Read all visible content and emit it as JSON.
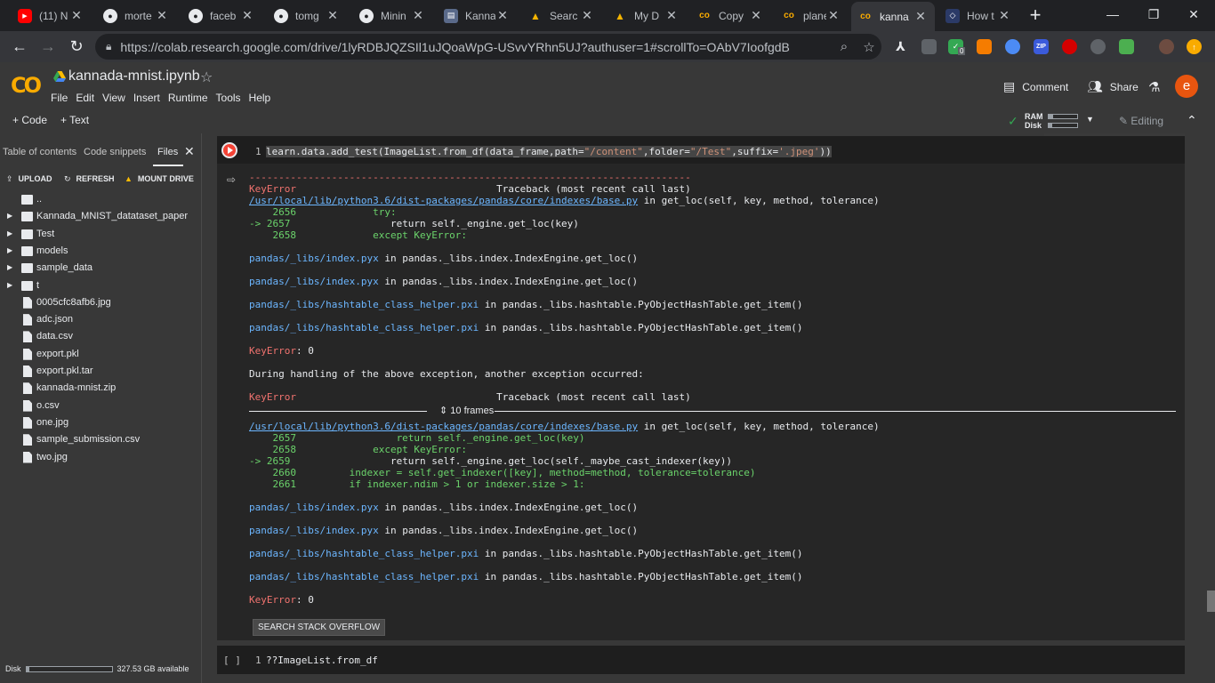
{
  "tabs": [
    {
      "label": "(11) N",
      "favicon": "youtube-icon",
      "color": "#ff0000",
      "glyph": "▶"
    },
    {
      "label": "morte",
      "favicon": "github-icon",
      "color": "#e8eaed",
      "glyph": "●"
    },
    {
      "label": "faceb",
      "favicon": "github-icon",
      "color": "#e8eaed",
      "glyph": "●"
    },
    {
      "label": "tomg",
      "favicon": "github-icon",
      "color": "#e8eaed",
      "glyph": "●"
    },
    {
      "label": "Minin",
      "favicon": "github-icon",
      "color": "#e8eaed",
      "glyph": "●"
    },
    {
      "label": "Kanna",
      "favicon": "paper-icon",
      "color": "#5a6a8a",
      "glyph": "▤"
    },
    {
      "label": "Searc",
      "favicon": "drive-icon",
      "color": "#f4b400",
      "glyph": "▲"
    },
    {
      "label": "My D",
      "favicon": "drive-icon",
      "color": "#f4b400",
      "glyph": "▲"
    },
    {
      "label": "Copy",
      "favicon": "colab-icon",
      "color": "#f9ab00",
      "glyph": "co"
    },
    {
      "label": "plane",
      "favicon": "colab-icon",
      "color": "#f9ab00",
      "glyph": "co"
    },
    {
      "label": "kanna",
      "favicon": "colab-icon",
      "color": "#f9ab00",
      "glyph": "co",
      "active": true
    },
    {
      "label": "How t",
      "favicon": "howto-icon",
      "color": "#2b3a67",
      "glyph": "◇"
    }
  ],
  "browser": {
    "url": "https://colab.research.google.com/drive/1lyRDBJQZSIl1uJQoaWpG-USvvYRhn5UJ?authuser=1#scrollTo=OAbV7IoofgdB",
    "ext_badge": "0"
  },
  "colab": {
    "logo": "CO",
    "title": "kannada-mnist.ipynb",
    "menu": [
      "File",
      "Edit",
      "View",
      "Insert",
      "Runtime",
      "Tools",
      "Help"
    ],
    "comment": "Comment",
    "share": "Share",
    "avatar": "e",
    "add_code": "+ Code",
    "add_text": "+ Text",
    "ram": "RAM",
    "disk": "Disk",
    "editing": "Editing"
  },
  "sidebar": {
    "tabs": [
      "Table of contents",
      "Code snippets",
      "Files"
    ],
    "actions": [
      "UPLOAD",
      "REFRESH",
      "MOUNT DRIVE"
    ],
    "files": [
      {
        "name": "..",
        "type": "up"
      },
      {
        "name": "Kannada_MNIST_datataset_paper",
        "type": "folder"
      },
      {
        "name": "Test",
        "type": "folder"
      },
      {
        "name": "models",
        "type": "folder"
      },
      {
        "name": "sample_data",
        "type": "folder"
      },
      {
        "name": "t",
        "type": "folder"
      },
      {
        "name": "0005cfc8afb6.jpg",
        "type": "file"
      },
      {
        "name": "adc.json",
        "type": "file"
      },
      {
        "name": "data.csv",
        "type": "file"
      },
      {
        "name": "export.pkl",
        "type": "file"
      },
      {
        "name": "export.pkl.tar",
        "type": "file"
      },
      {
        "name": "kannada-mnist.zip",
        "type": "file"
      },
      {
        "name": "o.csv",
        "type": "file"
      },
      {
        "name": "one.jpg",
        "type": "file"
      },
      {
        "name": "sample_submission.csv",
        "type": "file"
      },
      {
        "name": "two.jpg",
        "type": "file"
      }
    ],
    "disk_label": "Disk",
    "disk_available": "327.53 GB available",
    "disk_used_fraction": 0.04
  },
  "cell1": {
    "line_no": "1",
    "code_a": "learn.data.add_test(ImageList.from_df(data_frame,path=",
    "code_s1": "\"/content\"",
    "code_b": ",folder=",
    "code_s2": "\"/Test\"",
    "code_c": ",suffix=",
    "code_s3": "'.jpeg'",
    "code_d": "))"
  },
  "output": {
    "dashes": "---------------------------------------------------------------------------",
    "err1_name": "KeyError",
    "err1_tb": "                                  Traceback (most recent call last)",
    "path1": "/usr/local/lib/python3.6/dist-packages/pandas/core/indexes/base.py",
    "path1_tail": " in get_loc(self, key, method, tolerance)",
    "l2656": "    2656             try:",
    "l2657_arrow": "-> 2657",
    "l2657": "                 return self._engine.get_loc(key)",
    "l2658": "    2658             except KeyError:",
    "pyx1": "pandas/_libs/index.pyx",
    "pyx1_tail": " in pandas._libs.index.IndexEngine.get_loc()",
    "pyx2": "pandas/_libs/index.pyx",
    "pyx2_tail": " in pandas._libs.index.IndexEngine.get_loc()",
    "pxi1": "pandas/_libs/hashtable_class_helper.pxi",
    "pxi1_tail": " in pandas._libs.hashtable.PyObjectHashTable.get_item()",
    "pxi2": "pandas/_libs/hashtable_class_helper.pxi",
    "pxi2_tail": " in pandas._libs.hashtable.PyObjectHashTable.get_item()",
    "keyerror0_a": "KeyError",
    "keyerror0_b": ": 0",
    "during": "During handling of the above exception, another exception occurred:",
    "err2_name": "KeyError",
    "err2_tb": "                                  Traceback (most recent call last)",
    "frames": "10 frames",
    "path2": "/usr/local/lib/python3.6/dist-packages/pandas/core/indexes/base.py",
    "path2_tail": " in get_loc(self, key, method, tolerance)",
    "m2657": "    2657                 return self._engine.get_loc(key)",
    "m2658": "    2658             except KeyError:",
    "m2659_arrow": "-> 2659",
    "m2659": "                 return self._engine.get_loc(self._maybe_cast_indexer(key))",
    "m2660": "    2660         indexer = self.get_indexer([key], method=method, tolerance=tolerance)",
    "m2661": "    2661         if indexer.ndim > 1 or indexer.size > 1:",
    "pyx3": "pandas/_libs/index.pyx",
    "pyx3_tail": " in pandas._libs.index.IndexEngine.get_loc()",
    "pyx4": "pandas/_libs/index.pyx",
    "pyx4_tail": " in pandas._libs.index.IndexEngine.get_loc()",
    "pxi3": "pandas/_libs/hashtable_class_helper.pxi",
    "pxi3_tail": " in pandas._libs.hashtable.PyObjectHashTable.get_item()",
    "pxi4": "pandas/_libs/hashtable_class_helper.pxi",
    "pxi4_tail": " in pandas._libs.hashtable.PyObjectHashTable.get_item()",
    "keyerror1_a": "KeyError",
    "keyerror1_b": ": 0",
    "so_button": "SEARCH STACK OVERFLOW"
  },
  "cell2": {
    "bracket": "[ ]",
    "line_no": "1",
    "code": "??ImageList.from_df"
  }
}
